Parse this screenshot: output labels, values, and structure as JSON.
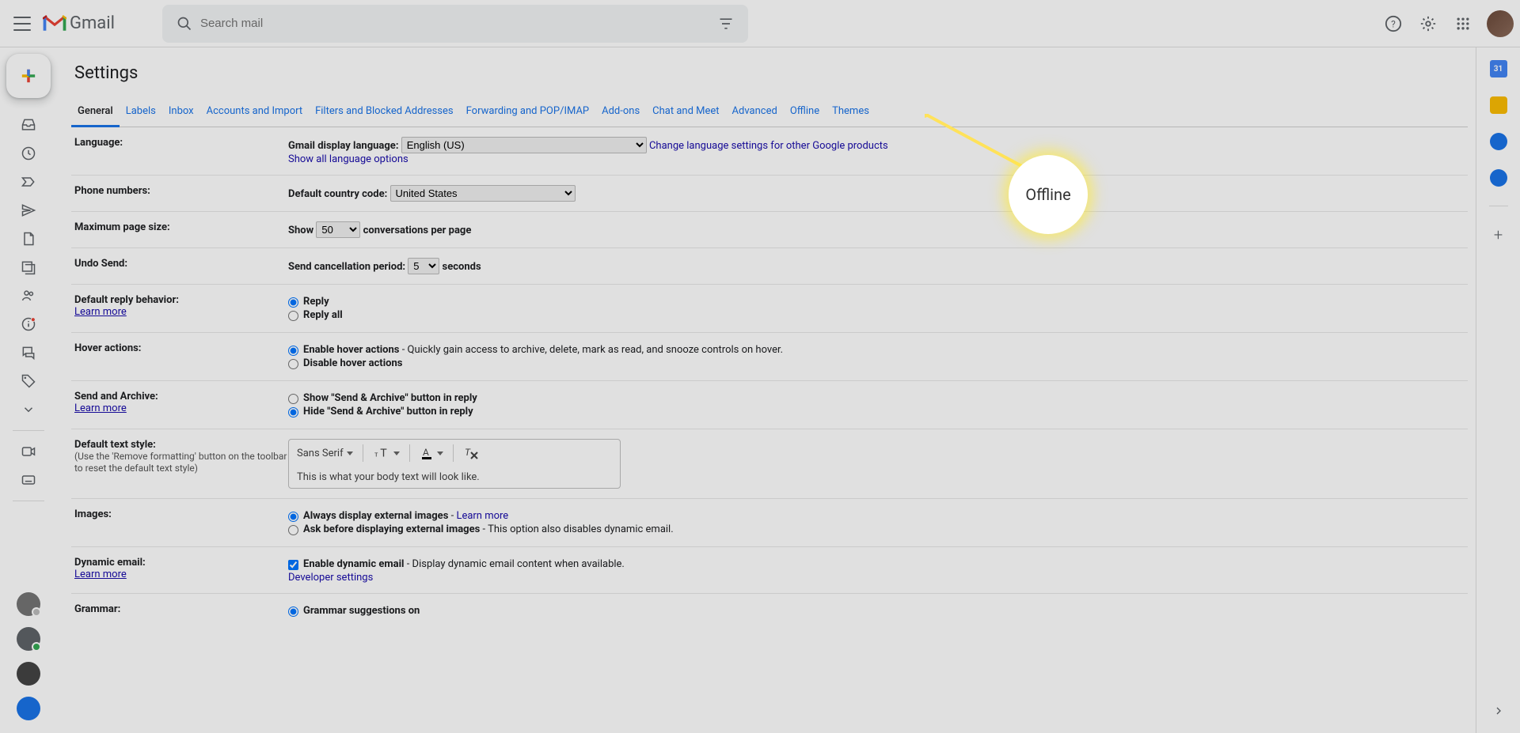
{
  "header": {
    "logo_text": "Gmail",
    "search_placeholder": "Search mail"
  },
  "page_title": "Settings",
  "callout_text": "Offline",
  "right_panel": {
    "calendar_day": "31"
  },
  "tabs": [
    {
      "label": "General",
      "active": true
    },
    {
      "label": "Labels"
    },
    {
      "label": "Inbox"
    },
    {
      "label": "Accounts and Import"
    },
    {
      "label": "Filters and Blocked Addresses"
    },
    {
      "label": "Forwarding and POP/IMAP"
    },
    {
      "label": "Add-ons"
    },
    {
      "label": "Chat and Meet"
    },
    {
      "label": "Advanced"
    },
    {
      "label": "Offline"
    },
    {
      "label": "Themes"
    }
  ],
  "settings": {
    "language": {
      "label": "Language:",
      "display_label": "Gmail display language:",
      "selected": "English (US)",
      "change_link": "Change language settings for other Google products",
      "show_all_link": "Show all language options"
    },
    "phone": {
      "label": "Phone numbers:",
      "code_label": "Default country code:",
      "selected": "United States"
    },
    "page_size": {
      "label": "Maximum page size:",
      "show": "Show",
      "value": "50",
      "suffix": "conversations per page"
    },
    "undo": {
      "label": "Undo Send:",
      "prefix": "Send cancellation period:",
      "value": "5",
      "suffix": "seconds"
    },
    "reply": {
      "label": "Default reply behavior:",
      "learn_more": "Learn more",
      "opt_reply": "Reply",
      "opt_reply_all": "Reply all"
    },
    "hover": {
      "label": "Hover actions:",
      "enable": "Enable hover actions",
      "enable_desc": " - Quickly gain access to archive, delete, mark as read, and snooze controls on hover.",
      "disable": "Disable hover actions"
    },
    "send_archive": {
      "label": "Send and Archive:",
      "learn_more": "Learn more",
      "show_opt": "Show \"Send & Archive\" button in reply",
      "hide_opt": "Hide \"Send & Archive\" button in reply"
    },
    "text_style": {
      "label": "Default text style:",
      "sub": "(Use the 'Remove formatting' button on the toolbar to reset the default text style)",
      "font": "Sans Serif",
      "sample": "This is what your body text will look like."
    },
    "images": {
      "label": "Images:",
      "always": "Always display external images",
      "learn_more": "Learn more",
      "ask": "Ask before displaying external images",
      "ask_desc": " - This option also disables dynamic email."
    },
    "dynamic": {
      "label": "Dynamic email:",
      "learn_more": "Learn more",
      "enable": "Enable dynamic email",
      "desc": " - Display dynamic email content when available.",
      "dev_link": "Developer settings"
    },
    "grammar": {
      "label": "Grammar:",
      "on": "Grammar suggestions on"
    }
  }
}
